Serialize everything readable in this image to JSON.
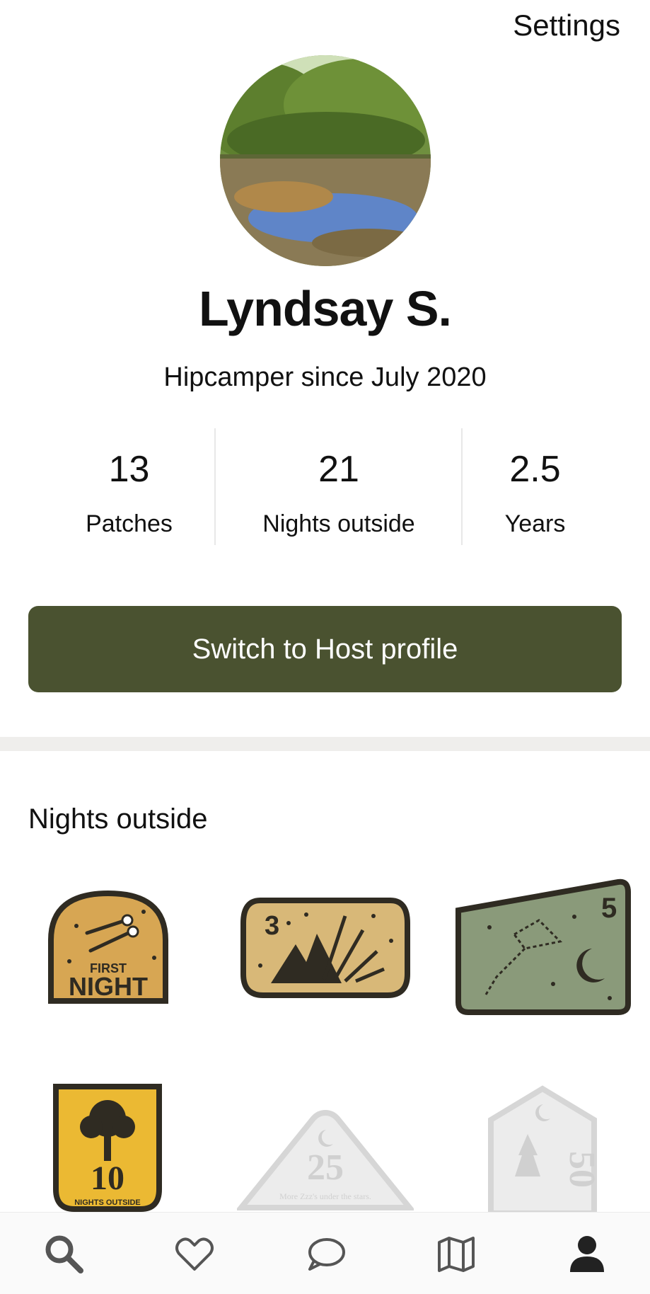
{
  "header": {
    "settings_label": "Settings"
  },
  "profile": {
    "name": "Lyndsay S.",
    "since": "Hipcamper since July 2020"
  },
  "stats": [
    {
      "value": "13",
      "label": "Patches"
    },
    {
      "value": "21",
      "label": "Nights outside"
    },
    {
      "value": "2.5",
      "label": "Years"
    }
  ],
  "host_button_label": "Switch to Host profile",
  "section": {
    "title": "Nights outside"
  },
  "patches": [
    {
      "top": "FIRST",
      "bottom": "NIGHT",
      "earned": true
    },
    {
      "number": "3",
      "earned": true
    },
    {
      "number": "5",
      "earned": true
    },
    {
      "number": "10",
      "caption": "NIGHTS OUTSIDE",
      "earned": true
    },
    {
      "number": "25",
      "caption": "More Zzz's under the stars.",
      "earned": false
    },
    {
      "number": "50",
      "earned": false
    }
  ],
  "nav": [
    "search-icon",
    "heart-icon",
    "chat-icon",
    "map-icon",
    "profile-icon"
  ],
  "colors": {
    "accent": "#4a5230",
    "patch_gold": "#d7a653",
    "patch_tan": "#d8b878",
    "patch_green": "#8a9a7a",
    "patch_yellow": "#ebb933",
    "locked": "#dcdcdc"
  }
}
